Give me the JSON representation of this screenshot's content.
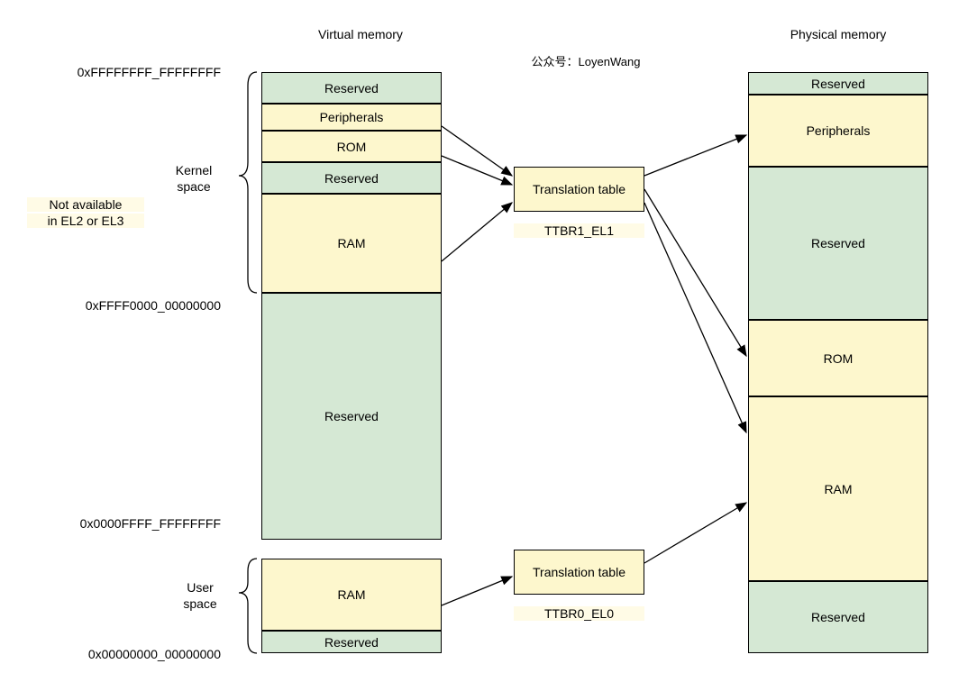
{
  "headers": {
    "virtual": "Virtual memory",
    "physical": "Physical memory"
  },
  "watermark": "公众号：LoyenWang",
  "addresses": {
    "top": "0xFFFFFFFF_FFFFFFFF",
    "kernel_bottom": "0xFFFF0000_00000000",
    "user_top": "0x0000FFFF_FFFFFFFF",
    "bottom": "0x00000000_00000000"
  },
  "left_labels": {
    "not_available_l1": "Not available",
    "not_available_l2": "in EL2 or EL3",
    "kernel_space_l1": "Kernel",
    "kernel_space_l2": "space",
    "user_space_l1": "User",
    "user_space_l2": "space"
  },
  "virtual_blocks": {
    "reserved1": "Reserved",
    "peripherals": "Peripherals",
    "rom": "ROM",
    "reserved2": "Reserved",
    "ram1": "RAM",
    "reserved3": "Reserved",
    "ram2": "RAM",
    "reserved4": "Reserved"
  },
  "translation": {
    "table1": "Translation table",
    "ttbr1": "TTBR1_EL1",
    "table2": "Translation table",
    "ttbr0": "TTBR0_EL0"
  },
  "physical_blocks": {
    "reserved1": "Reserved",
    "peripherals": "Peripherals",
    "reserved2": "Reserved",
    "rom": "ROM",
    "ram": "RAM",
    "reserved3": "Reserved"
  }
}
